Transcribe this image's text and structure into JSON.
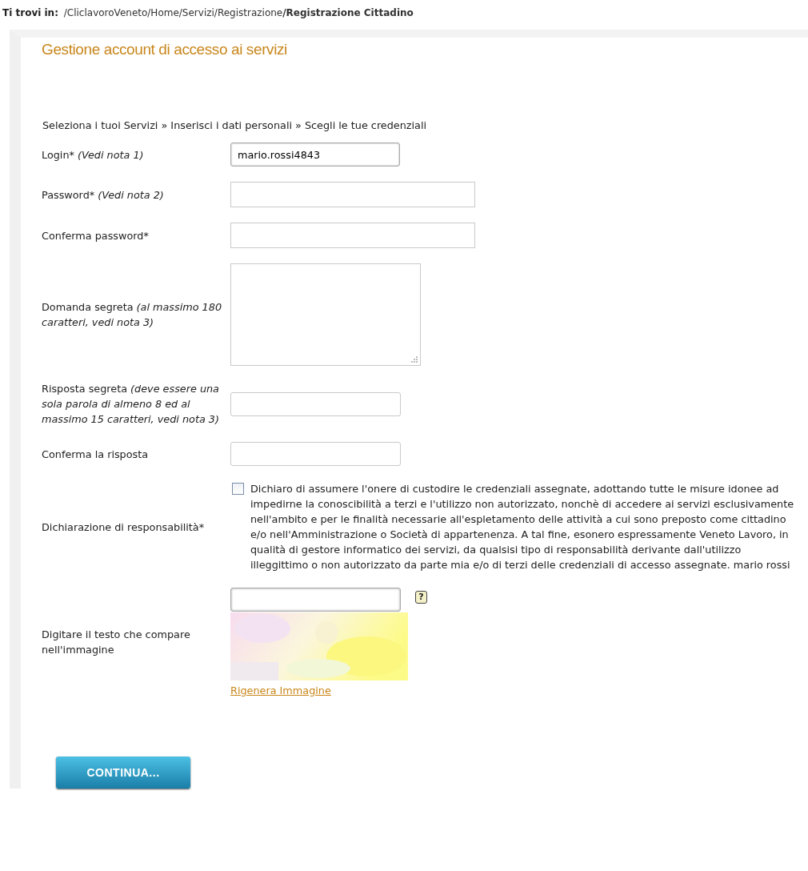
{
  "breadcrumb": {
    "label": "Ti trovi in:",
    "items": [
      {
        "text": "/CliclavoroVeneto",
        "current": false
      },
      {
        "text": "/Home",
        "current": false
      },
      {
        "text": "/Servizi",
        "current": false
      },
      {
        "text": "/Registrazione",
        "current": false
      },
      {
        "text": "/Registrazione Cittadino",
        "current": true
      }
    ]
  },
  "title": "Gestione account di accesso ai servizi",
  "steps": "Seleziona i tuoi Servizi » Inserisci i dati personali » Scegli le tue credenziali",
  "fields": [
    {
      "kind": "text",
      "label": "Login* *(Vedi nota 1)*",
      "value": "mario.rossi4843"
    },
    {
      "kind": "password",
      "label": "Password* *(Vedi nota 2)*"
    },
    {
      "kind": "password",
      "label": "Conferma password*"
    },
    {
      "kind": "textarea",
      "label": "Domanda segreta *(al massimo 180 caratteri, vedi nota 3)*"
    },
    {
      "kind": "short",
      "label": "Risposta segreta *(deve essere una sola parola di almeno 8 ed al massimo 15 caratteri, vedi nota 3)*"
    },
    {
      "kind": "short",
      "label": "Conferma la risposta"
    },
    {
      "kind": "checkbox",
      "label": "Dichiarazione di responsabilità*",
      "checked": false,
      "text": "Dichiaro di assumere l'onere di custodire le credenziali assegnate, adottando tutte le misure idonee ad impedirne la conoscibilità a terzi e l'utilizzo non autorizzato, nonchè di accedere ai servizi esclusivamente nell'ambito e per le finalità necessarie all'espletamento delle attività a cui sono preposto come cittadino e/o nell'Amministrazione o Società di appartenenza. A tal fine, esonero espressamente Veneto Lavoro, in qualità di gestore informatico dei servizi, da qualsisi tipo di responsabilità derivante dall'utilizzo illeggittimo o non autorizzato da parte mia e/o di terzi delle credenziali di accesso assegnate. mario rossi"
    },
    {
      "kind": "captcha",
      "label": "Digitare il testo che compare nell'immagine",
      "help": "?",
      "link": "Rigenera Immagine"
    }
  ],
  "submit": "CONTINUA..."
}
